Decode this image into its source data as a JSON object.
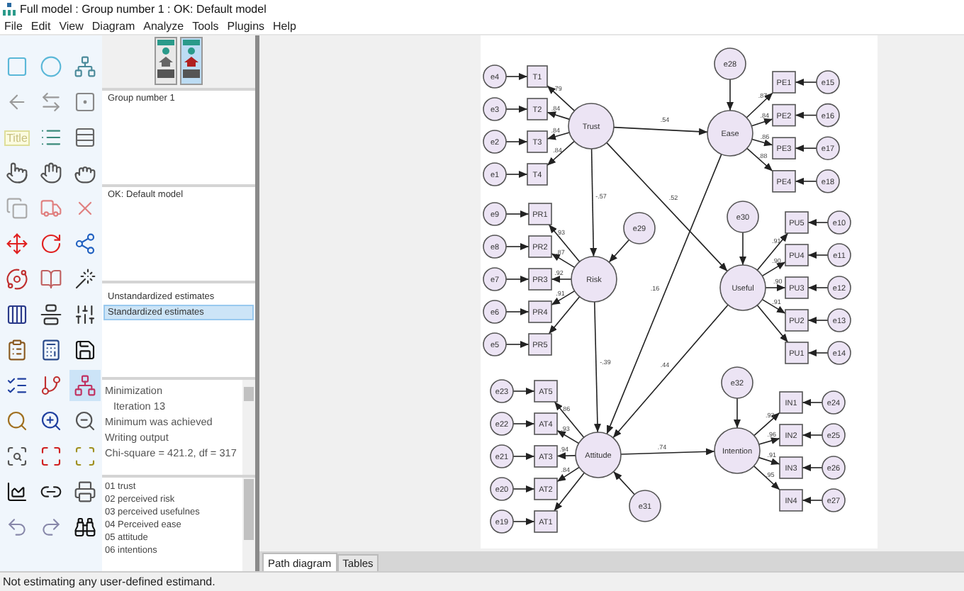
{
  "window": {
    "title": "Full model : Group number 1 : OK: Default model"
  },
  "menu": [
    "File",
    "Edit",
    "View",
    "Diagram",
    "Analyze",
    "Tools",
    "Plugins",
    "Help"
  ],
  "toolbar": {
    "tools": [
      {
        "selected": false
      },
      {
        "selected": false
      },
      {
        "selected": false
      },
      {
        "selected": false
      },
      {
        "selected": false
      },
      {
        "selected": false
      },
      {
        "label": "Title",
        "selected": false
      },
      {
        "selected": false
      },
      {
        "selected": false
      },
      {
        "selected": false
      },
      {
        "selected": false
      },
      {
        "selected": false
      },
      {
        "selected": false
      },
      {
        "selected": false
      },
      {
        "selected": false
      },
      {
        "selected": false
      },
      {
        "selected": false
      },
      {
        "selected": false
      },
      {
        "selected": false
      },
      {
        "selected": false
      },
      {
        "selected": false
      },
      {
        "selected": false
      },
      {
        "selected": false
      },
      {
        "selected": false
      },
      {
        "selected": false
      },
      {
        "selected": false
      },
      {
        "selected": false
      },
      {
        "selected": false
      },
      {
        "selected": false
      },
      {
        "selected": true
      },
      {
        "selected": false
      },
      {
        "selected": false
      },
      {
        "selected": false
      },
      {
        "selected": false
      },
      {
        "selected": false
      },
      {
        "selected": false
      },
      {
        "selected": false
      },
      {
        "selected": false
      },
      {
        "selected": false
      },
      {
        "selected": false
      },
      {
        "selected": false
      },
      {
        "selected": false
      }
    ]
  },
  "view_buttons": [
    {
      "selected": false
    },
    {
      "selected": true
    }
  ],
  "groups": {
    "items": [
      {
        "label": "Group number 1",
        "selected": false
      }
    ]
  },
  "models": {
    "items": [
      {
        "label": "OK: Default model",
        "selected": false
      }
    ]
  },
  "estimates": {
    "items": [
      {
        "label": "Unstandardized estimates",
        "selected": false
      },
      {
        "label": "Standardized estimates",
        "selected": true
      }
    ]
  },
  "messages": [
    {
      "text": "Minimization",
      "indent": false
    },
    {
      "text": "Iteration 13",
      "indent": true
    },
    {
      "text": "Minimum was achieved",
      "indent": false
    },
    {
      "text": "Writing output",
      "indent": false
    },
    {
      "text": "Chi-square = 421.2, df = 317",
      "indent": false
    }
  ],
  "variable_sets": [
    "01 trust",
    "02 perceived risk",
    "03 perceived usefulnes",
    "04 Perceived  ease",
    "05 attitude",
    "06 intentions"
  ],
  "diagram": {
    "latents": [
      {
        "name": "Trust",
        "indicators": [
          {
            "name": "T1",
            "error": "e4",
            "loading": ".79"
          },
          {
            "name": "T2",
            "error": "e3",
            "loading": ".84"
          },
          {
            "name": "T3",
            "error": "e2",
            "loading": ".84"
          },
          {
            "name": "T4",
            "error": "e1",
            "loading": ".84"
          }
        ]
      },
      {
        "name": "Risk",
        "error": "e29",
        "indicators": [
          {
            "name": "PR1",
            "error": "e9",
            "loading": ".93"
          },
          {
            "name": "PR2",
            "error": "e8",
            "loading": ".87"
          },
          {
            "name": "PR3",
            "error": "e7",
            "loading": ".92"
          },
          {
            "name": "PR4",
            "error": "e6",
            "loading": ".91"
          },
          {
            "name": "PR5",
            "error": "e5"
          }
        ]
      },
      {
        "name": "Attitude",
        "error": "e31",
        "indicators": [
          {
            "name": "AT5",
            "error": "e23",
            "loading": ".86"
          },
          {
            "name": "AT4",
            "error": "e22",
            "loading": ".93"
          },
          {
            "name": "AT3",
            "error": "e21",
            "loading": ".94"
          },
          {
            "name": "AT2",
            "error": "e20",
            "loading": ".84"
          },
          {
            "name": "AT1",
            "error": "e19"
          }
        ]
      },
      {
        "name": "Ease",
        "error": "e28",
        "indicators": [
          {
            "name": "PE1",
            "error": "e15",
            "loading": ".87"
          },
          {
            "name": "PE2",
            "error": "e16",
            "loading": ".84"
          },
          {
            "name": "PE3",
            "error": "e17",
            "loading": ".86"
          },
          {
            "name": "PE4",
            "error": "e18",
            "loading": ".88"
          }
        ]
      },
      {
        "name": "Useful",
        "error": "e30",
        "indicators": [
          {
            "name": "PU5",
            "error": "e10",
            "loading": ".91"
          },
          {
            "name": "PU4",
            "error": "e11",
            "loading": ".90"
          },
          {
            "name": "PU3",
            "error": "e12",
            "loading": ".90"
          },
          {
            "name": "PU2",
            "error": "e13",
            "loading": ".91"
          },
          {
            "name": "PU1",
            "error": "e14"
          }
        ]
      },
      {
        "name": "Intention",
        "error": "e32",
        "indicators": [
          {
            "name": "IN1",
            "error": "e24",
            "loading": ".93"
          },
          {
            "name": "IN2",
            "error": "e25",
            "loading": ".96"
          },
          {
            "name": "IN3",
            "error": "e26",
            "loading": ".91"
          },
          {
            "name": "IN4",
            "error": "e27",
            "loading": ".95"
          }
        ]
      }
    ],
    "paths": [
      {
        "estimate": ".54"
      },
      {
        "estimate": ".52"
      },
      {
        "estimate": "-.57"
      },
      {
        "estimate": "-.39"
      },
      {
        "estimate": ".16"
      },
      {
        "estimate": ".44"
      },
      {
        "estimate": ".74"
      }
    ]
  },
  "tabs": [
    {
      "label": "Path diagram",
      "selected": true
    },
    {
      "label": "Tables",
      "selected": false
    }
  ],
  "status_bar": "Not estimating any user-defined estimand."
}
